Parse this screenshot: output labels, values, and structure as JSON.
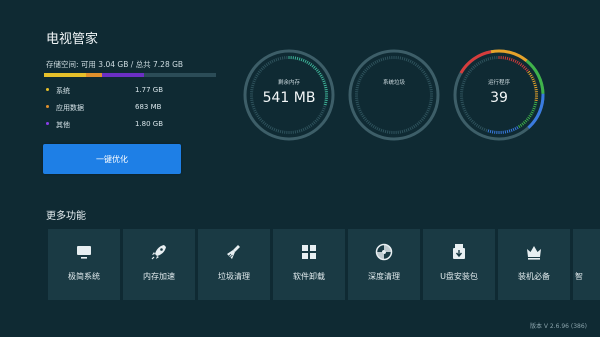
{
  "app": {
    "title": "电视管家"
  },
  "storage": {
    "summary": "存储空间: 可用 3.04 GB / 总共 7.28 GB",
    "bar": [
      {
        "name": "系统",
        "fraction": 0.243,
        "color": "#e6c02a"
      },
      {
        "name": "应用数据",
        "fraction": 0.092,
        "color": "#e0902c"
      },
      {
        "name": "其他",
        "fraction": 0.247,
        "color": "#6b2fc4"
      },
      {
        "name": "可用",
        "fraction": 0.418,
        "color": "#2b4c57"
      }
    ],
    "legend": [
      {
        "label": "系统",
        "value": "1.77 GB",
        "color": "#e6c02a"
      },
      {
        "label": "应用数据",
        "value": "683 MB",
        "color": "#e0902c"
      },
      {
        "label": "其他",
        "value": "1.80 GB",
        "color": "#8a3ee8"
      }
    ]
  },
  "optimize_button": {
    "label": "一键优化"
  },
  "gauges": [
    {
      "label": "剩余内存",
      "value": "541 MB",
      "fill": 0.3,
      "colors": [
        "#3fb59a"
      ]
    },
    {
      "label": "系统垃圾",
      "value": "",
      "fill": 0.0,
      "colors": []
    },
    {
      "label": "运行程序",
      "value": "39",
      "fill": 0.55,
      "colors": [
        "#d63c3c",
        "#e6a32a",
        "#3fb34a",
        "#3a7be0"
      ]
    }
  ],
  "more": {
    "title": "更多功能",
    "tiles": [
      {
        "label": "极简系统",
        "icon": "monitor-icon"
      },
      {
        "label": "内存加速",
        "icon": "rocket-icon"
      },
      {
        "label": "垃圾清理",
        "icon": "broom-icon"
      },
      {
        "label": "软件卸载",
        "icon": "app-grid-icon"
      },
      {
        "label": "深度清理",
        "icon": "disc-icon"
      },
      {
        "label": "U盘安装包",
        "icon": "usb-package-icon"
      },
      {
        "label": "装机必备",
        "icon": "crown-icon"
      },
      {
        "label": "智",
        "icon": "partial-tile-icon"
      }
    ]
  },
  "version": "版本 V 2.6.96 (386)"
}
